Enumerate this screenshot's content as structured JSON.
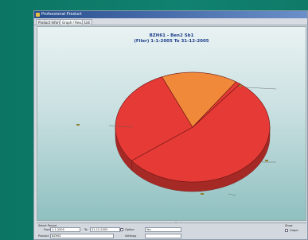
{
  "window": {
    "title": "Professional Product"
  },
  "tabs": [
    {
      "label": "Product Information"
    },
    {
      "label": "Graph / Result"
    },
    {
      "label": "List"
    }
  ],
  "chart_data": {
    "type": "pie",
    "title": "BZH61 - Ben2 Sb1",
    "subtitle": "(Filer) 1-1-2005 To 31-12-2005",
    "values": [
      54,
      29,
      16,
      1
    ],
    "colors": [
      "#e53a35",
      "#e53a35",
      "#f08a3a",
      "#e53a35"
    ],
    "labels": [
      "",
      "",
      "",
      ""
    ],
    "footer": "Back"
  },
  "panel": {
    "section_label": "Select Period",
    "from_label": "From",
    "from_value": "1-1-2005",
    "to_label": "To",
    "to_value": "31-12-2005",
    "product_label": "Product",
    "product_value": "BZH61",
    "option1_label": "Option",
    "option1_value": "Yes",
    "option2_label": "Settings",
    "right_label": "Show",
    "right_option": "Graph"
  }
}
